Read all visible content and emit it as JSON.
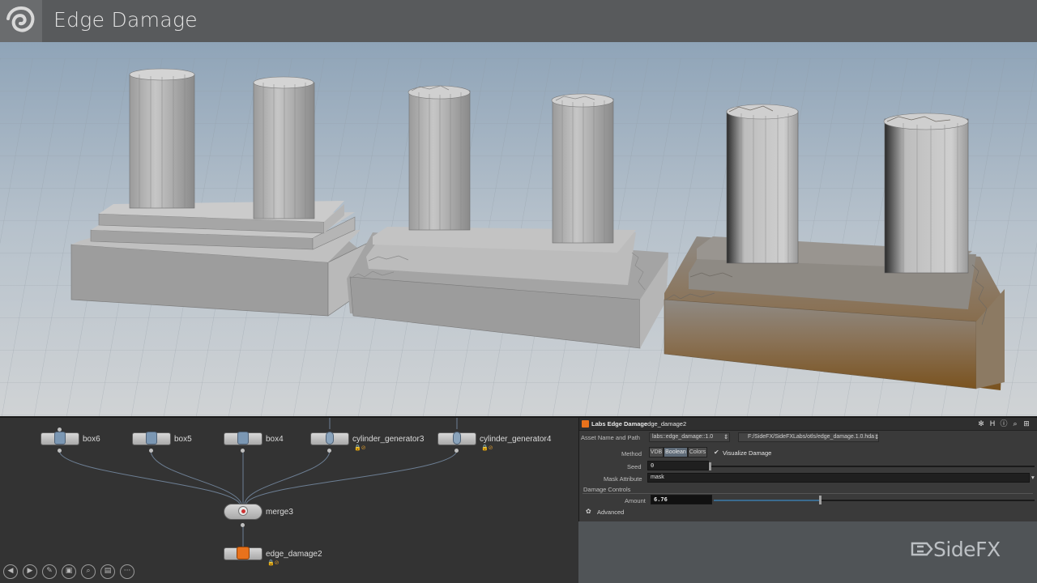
{
  "window": {
    "title": "Edge Damage"
  },
  "network": {
    "nodes": [
      {
        "id": "box6",
        "label": "box6",
        "icon": "box-icon",
        "flags": ""
      },
      {
        "id": "box5",
        "label": "box5",
        "icon": "box-icon",
        "flags": ""
      },
      {
        "id": "box4",
        "label": "box4",
        "icon": "box-icon",
        "flags": ""
      },
      {
        "id": "cylinder_generator3",
        "label": "cylinder_generator3",
        "icon": "cylinder-icon",
        "flags": "🔒⊘"
      },
      {
        "id": "cylinder_generator4",
        "label": "cylinder_generator4",
        "icon": "cylinder-icon",
        "flags": "🔒⊘"
      },
      {
        "id": "merge3",
        "label": "merge3",
        "icon": "merge-icon",
        "flags": ""
      },
      {
        "id": "edge_damage2",
        "label": "edge_damage2",
        "icon": "hda-icon",
        "flags": "🔒⊘"
      }
    ],
    "toolbar": [
      "back-icon",
      "forward-icon",
      "edit-icon",
      "layout-icon",
      "zoom-icon",
      "display-icon",
      "more-icon"
    ]
  },
  "parameters": {
    "node_type": "Labs Edge Damage",
    "node_name": "edge_damage2",
    "asset_label": "Asset Name and Path",
    "asset_name": "labs::edge_damage::1.0",
    "asset_path": "F:/SideFX/SideFXLabs/otls/edge_damage.1.0.hda",
    "method_label": "Method",
    "method_options": [
      "VDB",
      "Boolean",
      "Colors"
    ],
    "method_selected": "Boolean",
    "visualize_label": "Visualize Damage",
    "visualize_checked": true,
    "seed_label": "Seed",
    "seed_value": "0",
    "mask_label": "Mask Attribute",
    "mask_value": "mask",
    "damage_controls_label": "Damage Controls",
    "amount_label": "Amount",
    "amount_value": "6.76",
    "advanced_label": "Advanced"
  },
  "brand": {
    "name": "SideFX"
  },
  "colors": {
    "titlebar": "#585a5c",
    "accent_orange": "#e8721c",
    "slider_blue": "#3b6b8f"
  }
}
